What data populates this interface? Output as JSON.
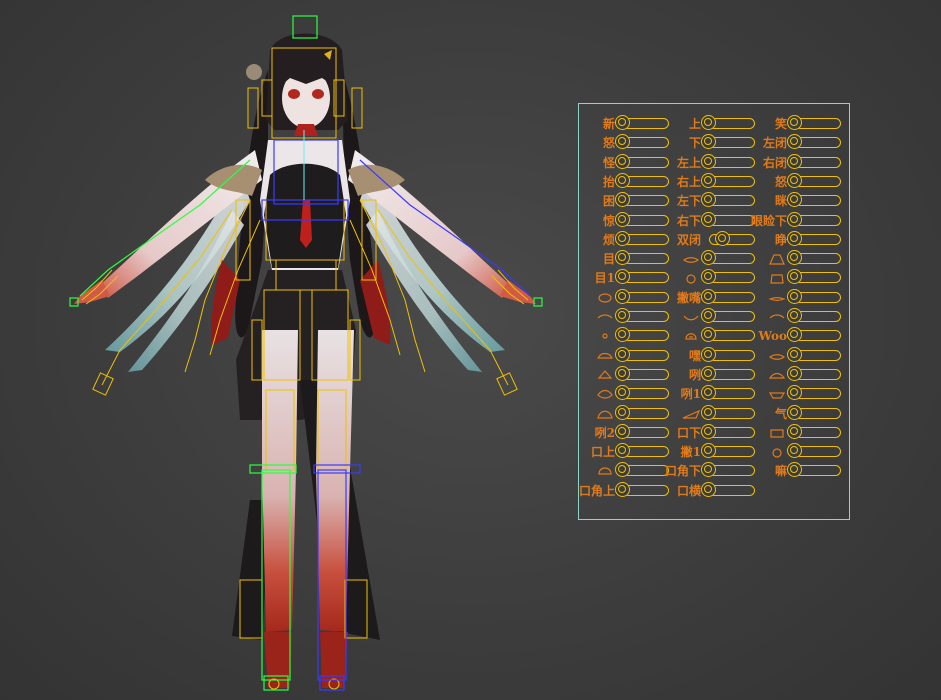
{
  "viewport": {
    "name": "3d-viewport",
    "colors": {
      "background": "#3f3f3f",
      "rig_yellow": "#f0c000",
      "rig_green": "#2aff40",
      "rig_blue": "#3a3aff",
      "panel_border": "#8fd4c8",
      "label_orange": "#e07a18"
    }
  },
  "morph_panel": {
    "columns": [
      [
        {
          "label": "新"
        },
        {
          "label": "怒"
        },
        {
          "label": "怪"
        },
        {
          "label": "抬"
        },
        {
          "label": "困"
        },
        {
          "label": "惊"
        },
        {
          "label": "烦"
        },
        {
          "label": "目"
        },
        {
          "label": "目1"
        },
        {
          "glyph": "oval"
        },
        {
          "glyph": "dash"
        },
        {
          "glyph": "dot"
        },
        {
          "glyph": "mouth-open"
        },
        {
          "glyph": "mouth-tri"
        },
        {
          "glyph": "mouth-wide"
        },
        {
          "glyph": "mouth-big"
        },
        {
          "label": "咧2"
        },
        {
          "label": "口上"
        },
        {
          "glyph": "mouth-round"
        },
        {
          "label": "口角上"
        }
      ],
      [
        {
          "label": "上"
        },
        {
          "label": "下"
        },
        {
          "label": "左上"
        },
        {
          "label": "右上"
        },
        {
          "label": "左下"
        },
        {
          "label": "右下"
        },
        {
          "label": "双闭",
          "wide": true
        },
        {
          "glyph": "lip"
        },
        {
          "glyph": "circle-small"
        },
        {
          "label": "撇嘴"
        },
        {
          "glyph": "mouth-smile"
        },
        {
          "glyph": "mouth-o"
        },
        {
          "label": "嘿"
        },
        {
          "label": "咧"
        },
        {
          "label": "咧1"
        },
        {
          "glyph": "mouth-long"
        },
        {
          "label": "口下"
        },
        {
          "label": "撇1"
        },
        {
          "label": "口角下"
        },
        {
          "label": "口横"
        }
      ],
      [
        {
          "label": "笑"
        },
        {
          "label": "左闭"
        },
        {
          "label": "右闭"
        },
        {
          "label": "怒"
        },
        {
          "label": "眯"
        },
        {
          "label": "眼睑下"
        },
        {
          "label": "睁"
        },
        {
          "glyph": "mouth-tent"
        },
        {
          "glyph": "mouth-sq"
        },
        {
          "glyph": "lip-thin"
        },
        {
          "glyph": "dash"
        },
        {
          "label": "Woo"
        },
        {
          "glyph": "lip"
        },
        {
          "glyph": "mouth-sad"
        },
        {
          "glyph": "mouth-flat"
        },
        {
          "label": "气"
        },
        {
          "glyph": "mouth-box"
        },
        {
          "glyph": "circle-small"
        },
        {
          "label": "嘛"
        }
      ]
    ]
  }
}
